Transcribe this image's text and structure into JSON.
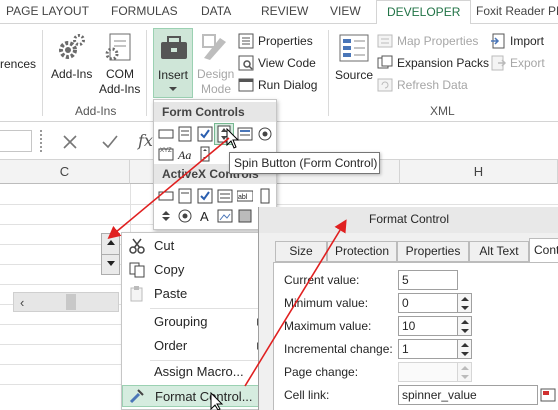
{
  "ribbon_tabs": {
    "page_layout": "PAGE LAYOUT",
    "formulas": "FORMULAS",
    "data": "DATA",
    "review": "REVIEW",
    "view": "VIEW",
    "developer": "DEVELOPER",
    "foxit": "Foxit Reader PDF"
  },
  "ribbon": {
    "references_partial": "rences",
    "addins_label": "Add-Ins",
    "com_addins_line1": "COM",
    "com_addins_line2": "Add-Ins",
    "addins_group": "Add-Ins",
    "insert_label": "Insert",
    "design_mode_line1": "Design",
    "design_mode_line2": "Mode",
    "properties": "Properties",
    "view_code": "View Code",
    "run_dialog": "Run Dialog",
    "source": "Source",
    "map_properties": "Map Properties",
    "expansion_packs": "Expansion Packs",
    "refresh_data": "Refresh Data",
    "import": "Import",
    "export": "Export",
    "xml_group": "XML"
  },
  "formula_bar": {
    "fx": "fx"
  },
  "grid": {
    "col_c": "C",
    "col_h": "H"
  },
  "insert_menu": {
    "form_controls": "Form Controls",
    "activex_controls": "ActiveX Controls"
  },
  "tooltip": "Spin Button (Form Control)",
  "context_menu": {
    "cut": "Cut",
    "copy": "Copy",
    "paste": "Paste",
    "grouping": "Grouping",
    "order": "Order",
    "assign_macro": "Assign Macro...",
    "format_control": "Format Control..."
  },
  "dialog": {
    "title": "Format Control",
    "tabs": [
      "Size",
      "Protection",
      "Properties",
      "Alt Text",
      "Control"
    ],
    "tab_control_partial": "Contr",
    "fields": {
      "current_value_label": "Current value:",
      "current_value": "5",
      "minimum_value_label": "Minimum value:",
      "minimum_value": "0",
      "maximum_value_label": "Maximum value:",
      "maximum_value": "10",
      "incremental_change_label": "Incremental change:",
      "incremental_change": "1",
      "page_change_label": "Page change:",
      "cell_link_label": "Cell link:",
      "cell_link": "spinner_value"
    }
  },
  "colors": {
    "developer_green": "#217346",
    "highlight_green": "#d5ecdf",
    "arrow_red": "#e02020"
  }
}
